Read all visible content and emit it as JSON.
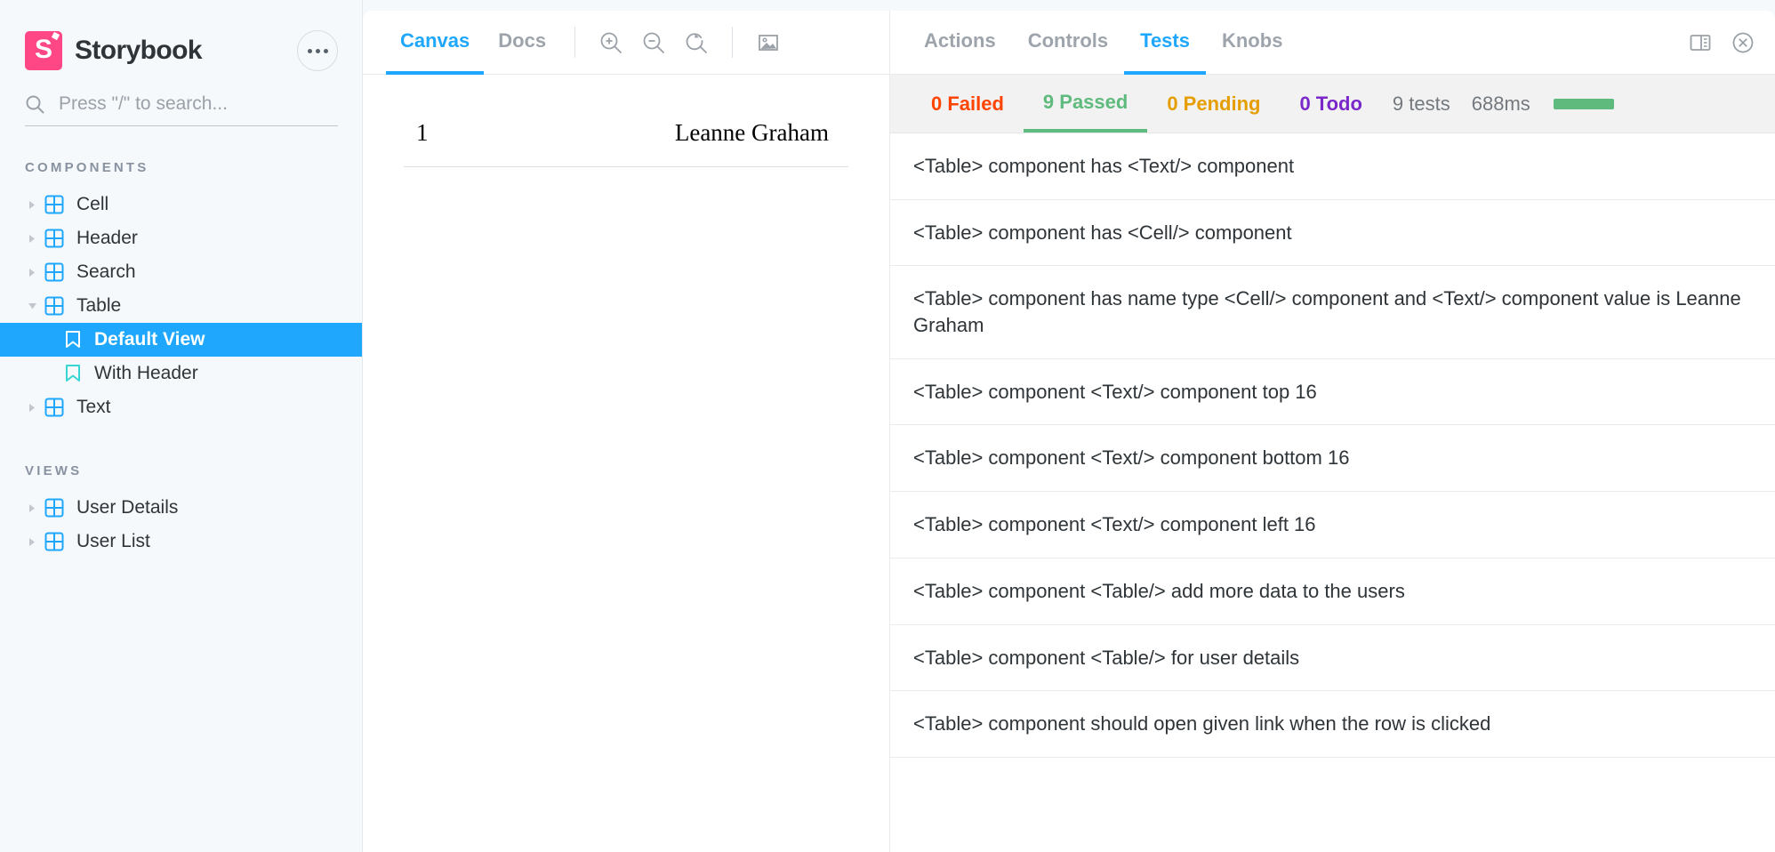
{
  "sidebar": {
    "brand": {
      "name": "Storybook",
      "logo_letter": "S",
      "logo_color": "#FF4785"
    },
    "menu_button": "more-options",
    "search": {
      "placeholder": "Press \"/\" to search...",
      "value": ""
    },
    "groups": [
      {
        "title": "COMPONENTS",
        "items": [
          {
            "label": "Cell",
            "type": "component",
            "expanded": false,
            "selected": false
          },
          {
            "label": "Header",
            "type": "component",
            "expanded": false,
            "selected": false
          },
          {
            "label": "Search",
            "type": "component",
            "expanded": false,
            "selected": false
          },
          {
            "label": "Table",
            "type": "component",
            "expanded": true,
            "selected": false
          },
          {
            "label": "Default View",
            "type": "story",
            "selected": true
          },
          {
            "label": "With Header",
            "type": "story",
            "selected": false
          },
          {
            "label": "Text",
            "type": "component",
            "expanded": false,
            "selected": false
          }
        ]
      },
      {
        "title": "VIEWS",
        "items": [
          {
            "label": "User Details",
            "type": "component",
            "expanded": false,
            "selected": false
          },
          {
            "label": "User List",
            "type": "component",
            "expanded": false,
            "selected": false
          }
        ]
      }
    ]
  },
  "canvas": {
    "tabs": [
      {
        "label": "Canvas",
        "active": true
      },
      {
        "label": "Docs",
        "active": false
      }
    ],
    "toolbar_icons": [
      "zoom-in-icon",
      "zoom-out-icon",
      "zoom-reset-icon",
      "image-icon"
    ],
    "preview": {
      "rows": [
        {
          "id": "1",
          "name": "Leanne Graham"
        }
      ]
    }
  },
  "panel": {
    "tabs": [
      {
        "label": "Actions",
        "active": false
      },
      {
        "label": "Controls",
        "active": false
      },
      {
        "label": "Tests",
        "active": true
      },
      {
        "label": "Knobs",
        "active": false
      }
    ],
    "actions": [
      "sidebar-layout-icon",
      "close-icon"
    ],
    "tests": {
      "summary": {
        "failed": {
          "label": "0 Failed",
          "color": "#FF4400"
        },
        "passed": {
          "label": "9 Passed",
          "color": "#5FBA7D"
        },
        "pending": {
          "label": "0 Pending",
          "color": "#E69D00"
        },
        "todo": {
          "label": "0 Todo",
          "color": "#7A28C9"
        },
        "count": "9 tests",
        "duration": "688ms",
        "progress_color": "#5FBA7D"
      },
      "items": [
        {
          "label": "<Table> component has <Text/> component"
        },
        {
          "label": "<Table> component has <Cell/> component"
        },
        {
          "label": "<Table> component has name type <Cell/> component and <Text/> component value is Leanne Graham"
        },
        {
          "label": "<Table> component <Text/> component top 16"
        },
        {
          "label": "<Table> component <Text/> component bottom 16"
        },
        {
          "label": "<Table> component <Text/> component left 16"
        },
        {
          "label": "<Table> component <Table/> add more data to the users"
        },
        {
          "label": "<Table> component <Table/> for user details"
        },
        {
          "label": "<Table> component should open given link when the row is clicked"
        }
      ]
    }
  }
}
